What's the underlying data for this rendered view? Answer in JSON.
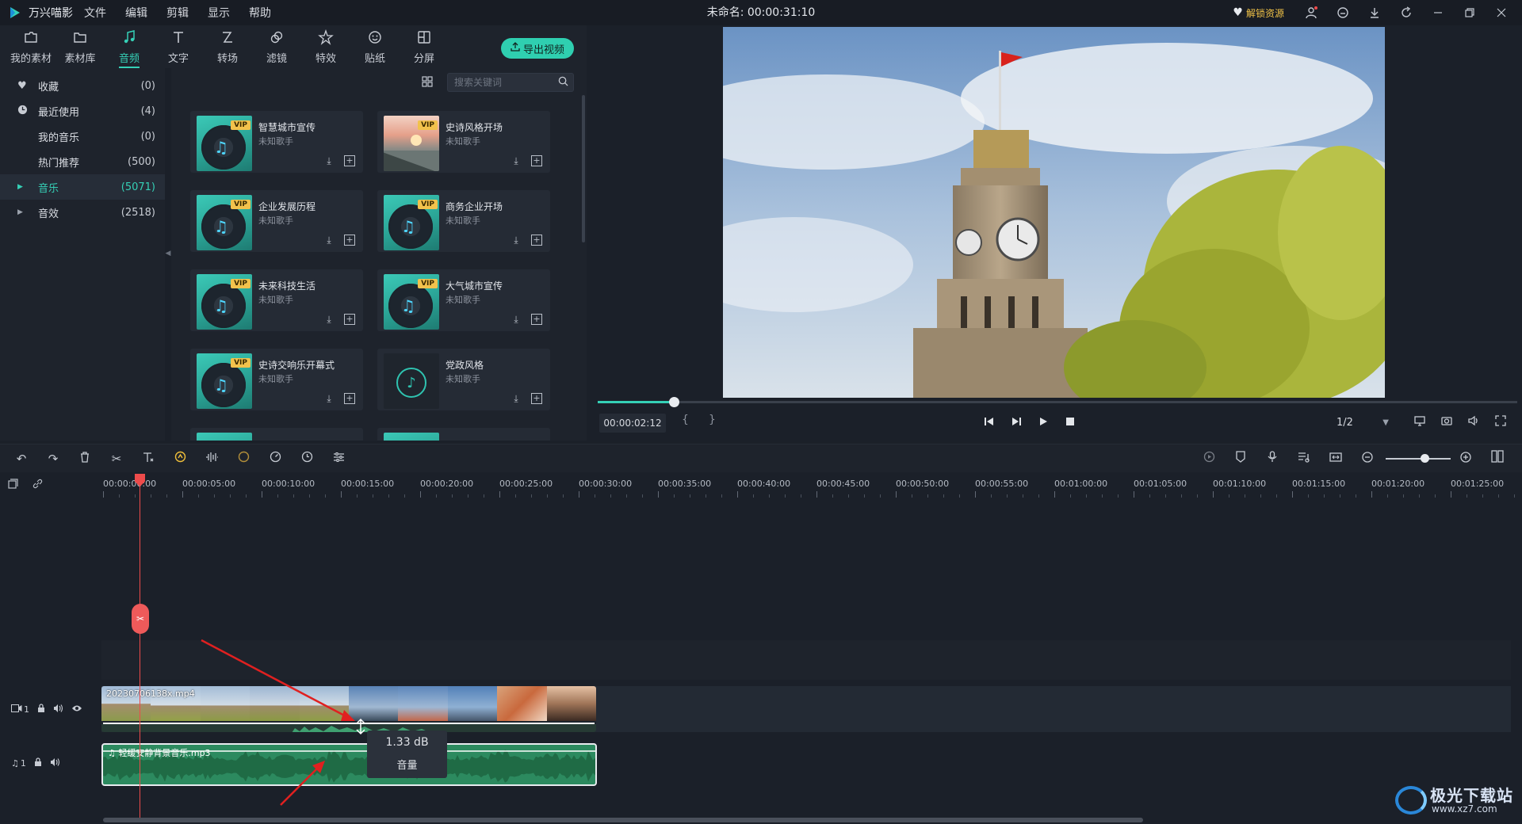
{
  "app": {
    "name": "万兴喵影",
    "menu": [
      "文件",
      "编辑",
      "剪辑",
      "显示",
      "帮助"
    ],
    "doc_title": "未命名: 00:00:31:10",
    "unlock_label": "解锁资源",
    "accent": "#35d0b6",
    "vip_color": "#f2c24c"
  },
  "media_tabs": [
    {
      "label": "我的素材",
      "icon": "folder-icon"
    },
    {
      "label": "素材库",
      "icon": "library-icon"
    },
    {
      "label": "音频",
      "icon": "music-note-icon",
      "active": true
    },
    {
      "label": "文字",
      "icon": "text-icon"
    },
    {
      "label": "转场",
      "icon": "transition-icon"
    },
    {
      "label": "滤镜",
      "icon": "filter-icon"
    },
    {
      "label": "特效",
      "icon": "effects-icon"
    },
    {
      "label": "贴纸",
      "icon": "sticker-icon"
    },
    {
      "label": "分屏",
      "icon": "split-screen-icon"
    }
  ],
  "export_label": "导出视频",
  "categories": [
    {
      "label": "收藏",
      "count": "(0)",
      "icon": "heart-icon"
    },
    {
      "label": "最近使用",
      "count": "(4)",
      "icon": "clock-icon"
    },
    {
      "label": "我的音乐",
      "count": "(0)"
    },
    {
      "label": "热门推荐",
      "count": "(500)"
    },
    {
      "label": "音乐",
      "count": "(5071)",
      "active": true,
      "expandable": true
    },
    {
      "label": "音效",
      "count": "(2518)",
      "expandable": true
    }
  ],
  "search": {
    "placeholder": "搜索关键词"
  },
  "audio_items": [
    {
      "name": "智慧城市宣传",
      "artist": "未知歌手",
      "vip": "VIP",
      "thumb": "music"
    },
    {
      "name": "史诗风格开场",
      "artist": "未知歌手",
      "vip": "VIP",
      "thumb": "landscape"
    },
    {
      "name": "企业发展历程",
      "artist": "未知歌手",
      "vip": "VIP",
      "thumb": "music"
    },
    {
      "name": "商务企业开场",
      "artist": "未知歌手",
      "vip": "VIP",
      "thumb": "music"
    },
    {
      "name": "未来科技生活",
      "artist": "未知歌手",
      "vip": "VIP",
      "thumb": "music"
    },
    {
      "name": "大气城市宣传",
      "artist": "未知歌手",
      "vip": "VIP",
      "thumb": "music"
    },
    {
      "name": "史诗交响乐开幕式",
      "artist": "未知歌手",
      "vip": "VIP",
      "thumb": "music"
    },
    {
      "name": "党政风格",
      "artist": "未知歌手",
      "vip": "",
      "thumb": "plain"
    }
  ],
  "player": {
    "timecode": "00:00:02:12",
    "progress": 0.083,
    "ratio": "1/2",
    "mark_in": "{",
    "mark_out": "}"
  },
  "ruler": {
    "labels": [
      "00:00:00:00",
      "00:00:05:00",
      "00:00:10:00",
      "00:00:15:00",
      "00:00:20:00",
      "00:00:25:00",
      "00:00:30:00",
      "00:00:35:00",
      "00:00:40:00",
      "00:00:45:00",
      "00:00:50:00",
      "00:00:55:00",
      "00:01:00:00",
      "00:01:05:00",
      "00:01:10:00",
      "00:01:15:00",
      "00:01:20:00",
      "00:01:25:00"
    ]
  },
  "tracks": {
    "video_track_label": "1",
    "audio_track_label": "1",
    "video_clip_name": "20230706138x.mp4",
    "audio_clip_name": "轻缓安静背景音乐.mp3"
  },
  "volume_tooltip": {
    "value": "1.33 dB",
    "label": "音量"
  },
  "watermark": {
    "title": "极光下载站",
    "url": "www.xz7.com"
  }
}
